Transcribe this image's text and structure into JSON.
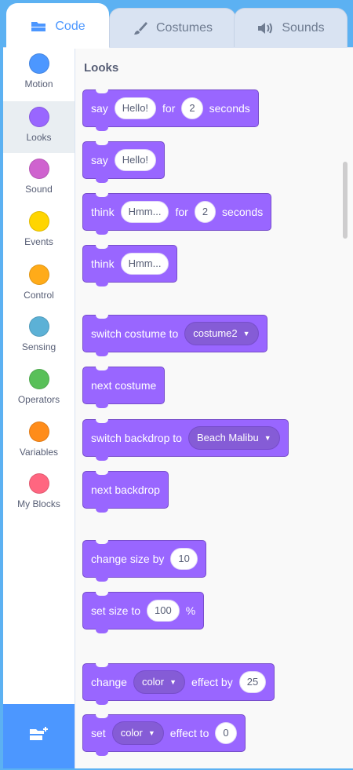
{
  "tabs": {
    "code": "Code",
    "costumes": "Costumes",
    "sounds": "Sounds"
  },
  "categories": [
    {
      "label": "Motion",
      "color": "#4c97ff"
    },
    {
      "label": "Looks",
      "color": "#9966ff"
    },
    {
      "label": "Sound",
      "color": "#cf63cf"
    },
    {
      "label": "Events",
      "color": "#ffd500"
    },
    {
      "label": "Control",
      "color": "#ffab19"
    },
    {
      "label": "Sensing",
      "color": "#5cb1d6"
    },
    {
      "label": "Operators",
      "color": "#59c059"
    },
    {
      "label": "Variables",
      "color": "#ff8c1a"
    },
    {
      "label": "My Blocks",
      "color": "#ff6680"
    }
  ],
  "selected_category": "Looks",
  "palette": {
    "section_title": "Looks",
    "blocks": {
      "say_for": {
        "t1": "say",
        "v1": "Hello!",
        "t2": "for",
        "v2": "2",
        "t3": "seconds"
      },
      "say": {
        "t1": "say",
        "v1": "Hello!"
      },
      "think_for": {
        "t1": "think",
        "v1": "Hmm...",
        "t2": "for",
        "v2": "2",
        "t3": "seconds"
      },
      "think": {
        "t1": "think",
        "v1": "Hmm..."
      },
      "switch_costume": {
        "t1": "switch costume to",
        "v1": "costume2"
      },
      "next_costume": {
        "t1": "next costume"
      },
      "switch_backdrop": {
        "t1": "switch backdrop to",
        "v1": "Beach Malibu"
      },
      "next_backdrop": {
        "t1": "next backdrop"
      },
      "change_size": {
        "t1": "change size by",
        "v1": "10"
      },
      "set_size": {
        "t1": "set size to",
        "v1": "100",
        "t2": "%"
      },
      "change_effect": {
        "t1": "change",
        "v1": "color",
        "t2": "effect by",
        "v2": "25"
      },
      "set_effect": {
        "t1": "set",
        "v1": "color",
        "t2": "effect to",
        "v2": "0"
      }
    }
  },
  "colors": {
    "looks_block": "#9966ff",
    "accent": "#4c97ff"
  }
}
